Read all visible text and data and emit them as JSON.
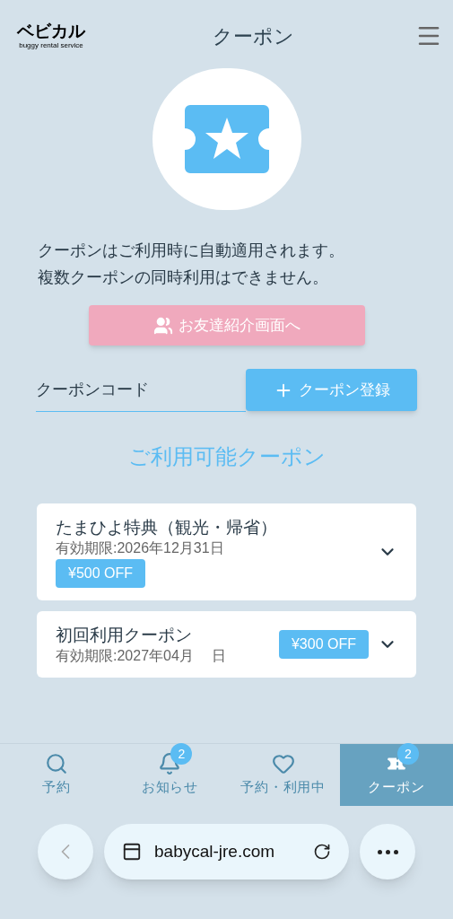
{
  "header": {
    "logo": "ベビカル",
    "logo_sub": "buggy rental service",
    "title": "クーポン"
  },
  "notice": [
    "クーポンはご利用時に自動適用されます。",
    "複数クーポンの同時利用はできません。"
  ],
  "referral_button": "お友達紹介画面へ",
  "code_field": {
    "placeholder": "クーポンコード"
  },
  "register_button": "クーポン登録",
  "section_title": "ご利用可能クーポン",
  "coupons": [
    {
      "kind": "stacked",
      "name": "たまひよ特典（観光・帰省）",
      "expiry": "有効期限:2026年12月31日",
      "discount": "¥500 OFF",
      "expanded": false
    },
    {
      "kind": "inline",
      "name": "初回利用クーポン",
      "expiry": "有効期限:2027年04月　 日",
      "discount": "¥300 OFF",
      "expanded": false
    }
  ],
  "bottom_nav": [
    {
      "kind": "search",
      "label": "予約",
      "selected": false
    },
    {
      "kind": "bell",
      "label": "お知らせ",
      "badge": "2",
      "selected": false
    },
    {
      "kind": "heart",
      "label": "予約・利用中",
      "selected": false
    },
    {
      "kind": "ticket",
      "label": "クーポン",
      "badge": "2",
      "selected": true
    }
  ],
  "browser": {
    "url": "babycal-jre.com"
  }
}
